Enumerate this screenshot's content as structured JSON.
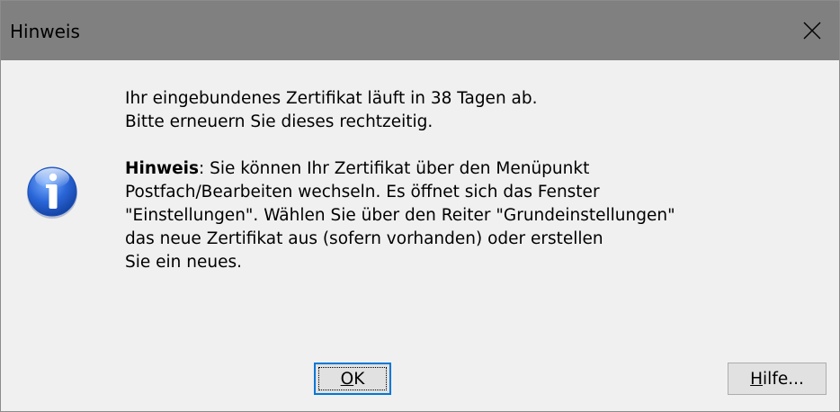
{
  "window": {
    "title": "Hinweis"
  },
  "icons": {
    "close": "close-icon",
    "info": "info-icon"
  },
  "message": {
    "line1": "Ihr eingebundenes Zertifikat läuft in 38 Tagen ab.",
    "line2": "Bitte erneuern Sie dieses rechtzeitig.",
    "hint_label": "Hinweis",
    "hint_line1_rest": ": Sie können Ihr Zertifikat über den Menüpunkt",
    "hint_line2": "Postfach/Bearbeiten wechseln. Es öffnet sich das Fenster",
    "hint_line3": "\"Einstellungen\". Wählen Sie über den Reiter \"Grundeinstellungen\"",
    "hint_line4": "das neue Zertifikat aus (sofern vorhanden) oder erstellen",
    "hint_line5": "Sie ein neues."
  },
  "buttons": {
    "ok_mnemonic": "O",
    "ok_rest": "K",
    "help_mnemonic": "H",
    "help_rest": "ilfe..."
  },
  "colors": {
    "titlebar": "#808080",
    "dialog_bg": "#f0f0f0",
    "button_bg": "#e1e1e1",
    "default_button_border": "#0078d7",
    "icon_blue": "#1f5cc8"
  }
}
